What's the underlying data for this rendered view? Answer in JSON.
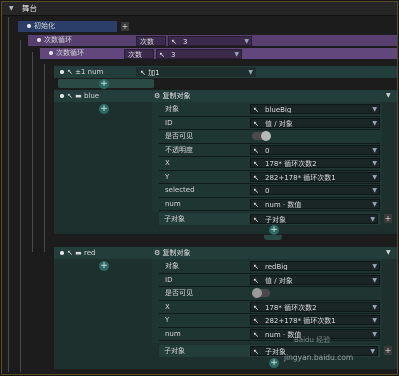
{
  "window": {
    "title": "舞台"
  },
  "init": {
    "label": "初始化"
  },
  "loop1": {
    "label": "次数循环",
    "count_field": "次数",
    "count_value": "3"
  },
  "loop2": {
    "label": "次数循环",
    "count_field": "次数",
    "count_value": "3"
  },
  "num_row": {
    "label": "±1 num",
    "value": "加1"
  },
  "blue": {
    "label": "blue",
    "action": "复制对象",
    "props": [
      {
        "name": "对象",
        "value": "blueBig"
      },
      {
        "name": "ID",
        "value": "值 / 对象"
      },
      {
        "name": "是否可见",
        "toggle": true
      },
      {
        "name": "不透明度",
        "value": "0"
      },
      {
        "name": "X",
        "value": "178* 循环次数2"
      },
      {
        "name": "Y",
        "value": "282+178* 循环次数1"
      },
      {
        "name": "selected",
        "value": "0"
      },
      {
        "name": "num",
        "value": "num · 数值"
      }
    ],
    "child_label": "子对象",
    "child_value": "子对象"
  },
  "red": {
    "label": "red",
    "action": "复制对象",
    "props": [
      {
        "name": "对象",
        "value": "redBig"
      },
      {
        "name": "ID",
        "value": "值 / 对象"
      },
      {
        "name": "是否可见",
        "toggle": false
      },
      {
        "name": "X",
        "value": "178* 循环次数2"
      },
      {
        "name": "Y",
        "value": "282+178* 循环次数1"
      },
      {
        "name": "num",
        "value": "num · 数值"
      }
    ],
    "child_label": "子对象",
    "child_value": "子对象"
  },
  "watermark": {
    "site": "jingyan.baidu.com"
  },
  "colors": {
    "init": "#2b3e6a",
    "loop": "#574070",
    "block": "#233d3a",
    "accent": "#2d6a63"
  },
  "icons": [
    "cursor-icon",
    "folder-icon",
    "gear-icon",
    "caret-down-icon",
    "plus-icon",
    "toggle-icon"
  ]
}
